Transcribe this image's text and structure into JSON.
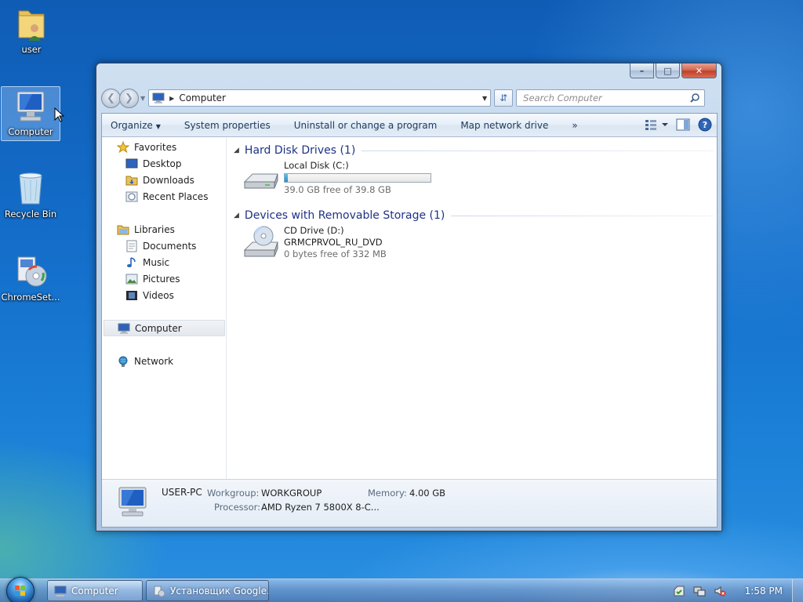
{
  "desktop": {
    "icons": [
      {
        "label": "user"
      },
      {
        "label": "Computer"
      },
      {
        "label": "Recycle Bin"
      },
      {
        "label": "ChromeSet..."
      }
    ]
  },
  "window": {
    "address": {
      "text": "Computer"
    },
    "search": {
      "placeholder": "Search Computer"
    },
    "toolbar": {
      "organize": "Organize",
      "system_properties": "System properties",
      "uninstall": "Uninstall or change a program",
      "map_drive": "Map network drive",
      "more": "»"
    },
    "nav": {
      "favorites": "Favorites",
      "desktop": "Desktop",
      "downloads": "Downloads",
      "recent_places": "Recent Places",
      "libraries": "Libraries",
      "documents": "Documents",
      "music": "Music",
      "pictures": "Pictures",
      "videos": "Videos",
      "computer": "Computer",
      "network": "Network"
    },
    "groups": {
      "hdd": "Hard Disk Drives (1)",
      "removable": "Devices with Removable Storage (1)"
    },
    "drives": {
      "c": {
        "name": "Local Disk (C:)",
        "free": "39.0 GB free of 39.8 GB",
        "used_fraction": 0.02
      },
      "d": {
        "name": "CD Drive (D:)",
        "label": "GRMCPRVOL_RU_DVD",
        "free": "0 bytes free of 332 MB"
      }
    },
    "details": {
      "name": "USER-PC",
      "workgroup_label": "Workgroup:",
      "workgroup": "WORKGROUP",
      "memory_label": "Memory:",
      "memory": "4.00 GB",
      "processor_label": "Processor:",
      "processor": "AMD Ryzen 7 5800X 8-C..."
    }
  },
  "taskbar": {
    "buttons": [
      {
        "label": "Computer"
      },
      {
        "label": "Установщик Google..."
      }
    ],
    "clock": "1:58 PM"
  }
}
